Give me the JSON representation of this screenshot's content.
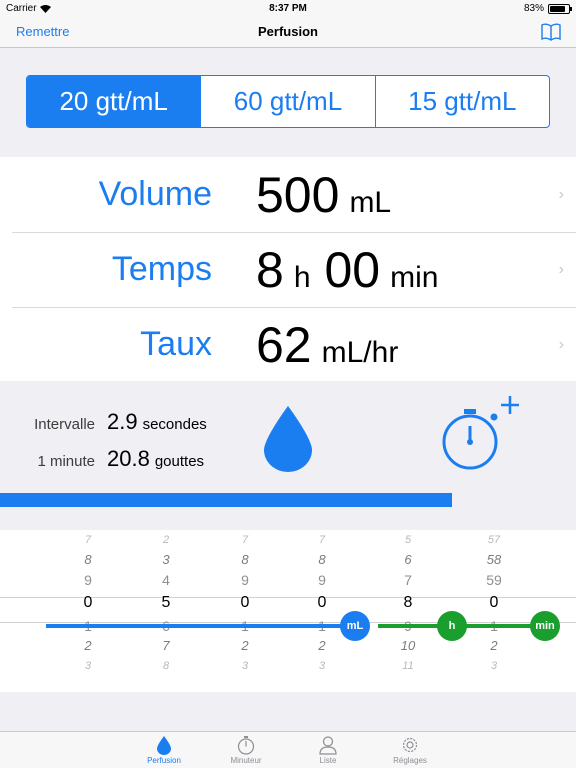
{
  "status": {
    "carrier": "Carrier",
    "time": "8:37 PM",
    "battery": "83%",
    "battery_level": 0.83
  },
  "nav": {
    "reset": "Remettre",
    "title": "Perfusion",
    "book_icon": "book-icon"
  },
  "drop_factor": {
    "options": [
      "20 gtt/mL",
      "60 gtt/mL",
      "15 gtt/mL"
    ],
    "selected": 0
  },
  "rows": {
    "volume": {
      "label": "Volume",
      "value": "500",
      "unit": "mL"
    },
    "time": {
      "label": "Temps",
      "hours": "8",
      "h_unit": "h",
      "minutes": "00",
      "min_unit": "min"
    },
    "rate": {
      "label": "Taux",
      "value": "62",
      "unit": "mL/hr"
    }
  },
  "info": {
    "interval_label": "Intervalle",
    "interval_value": "2.9",
    "interval_unit": "secondes",
    "minute_label": "1 minute",
    "minute_value": "20.8",
    "minute_unit": "gouttes"
  },
  "progress": 0.785,
  "picker": {
    "columns": [
      {
        "values": [
          "7",
          "8",
          "9",
          "0",
          "1",
          "2",
          "3"
        ]
      },
      {
        "values": [
          "2",
          "3",
          "4",
          "5",
          "6",
          "7",
          "8"
        ]
      },
      {
        "values": [
          "7",
          "8",
          "9",
          "0",
          "1",
          "2",
          "3"
        ]
      },
      {
        "values": [
          "7",
          "8",
          "9",
          "0",
          "1",
          "2",
          "3"
        ]
      },
      {
        "values": [
          "5",
          "6",
          "7",
          "8",
          "9",
          "10",
          "11"
        ]
      },
      {
        "values": [
          "57",
          "58",
          "59",
          "0",
          "1",
          "2",
          "3"
        ]
      }
    ],
    "badge_ml": "mL",
    "badge_h": "h",
    "badge_min": "min"
  },
  "tabs": [
    "Perfusion",
    "Minuteur",
    "Liste",
    "Réglages"
  ],
  "colors": {
    "accent": "#1b7ef0",
    "green": "#1a9e2e"
  }
}
